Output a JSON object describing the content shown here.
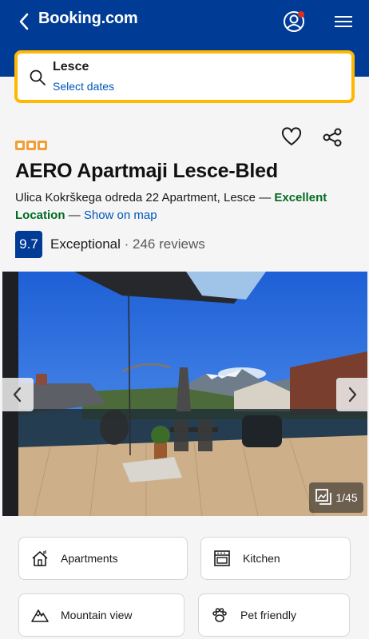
{
  "header": {
    "brand": "Booking.com",
    "back_icon": "back-arrow-icon",
    "account_icon": "account-icon",
    "menu_icon": "hamburger-menu-icon",
    "bg_color": "#003b95"
  },
  "search": {
    "destination": "Lesce",
    "dates_label": "Select dates",
    "border_color": "#ffb700"
  },
  "property": {
    "star_count": 3,
    "name": "AERO Apartmaji Lesce-Bled",
    "address": "Ulica Kokrškega odreda 22 Apartment, Lesce",
    "separator": "—",
    "location_label": "Excellent Location",
    "map_link": "Show on map",
    "score": "9.7",
    "score_word": "Exceptional",
    "reviews": "246 reviews"
  },
  "gallery": {
    "counter": "1/45"
  },
  "facilities": [
    {
      "label": "Apartments",
      "icon": "house-icon"
    },
    {
      "label": "Kitchen",
      "icon": "oven-icon"
    },
    {
      "label": "Mountain view",
      "icon": "mountain-icon"
    },
    {
      "label": "Pet friendly",
      "icon": "paw-icon"
    }
  ]
}
